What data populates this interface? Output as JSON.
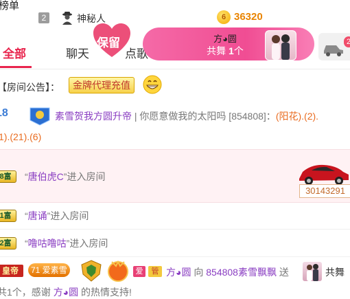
{
  "rank": {
    "label": "榜单",
    "position": "2",
    "user_name": "神秘人",
    "coin_symbol": "6",
    "coin_value": "36320"
  },
  "tabs": {
    "all": "全部",
    "chat": "聊天",
    "song": "点歌",
    "heart_label": "保留",
    "car_count": "2"
  },
  "banner": {
    "title": "方◕圆",
    "sub_prefix": "共舞 ",
    "sub_count": "1",
    "sub_suffix": "个"
  },
  "notice": {
    "label": "【房间公告】：",
    "button": "金牌代理充值"
  },
  "msg1": {
    "level": "18",
    "sender": "素雪贺我方圆升帝",
    "separator": " | ",
    "song": "你愿意做我的太阳吗",
    "id": " [854808]：",
    "content1": "(阳花).(2).",
    "content2": "1).(21).(6)"
  },
  "enter1": {
    "badge": "8富",
    "quote_open": "“",
    "name": "唐伯虎C",
    "quote_close": "”",
    "action": "进入房间",
    "car_price": "30143291"
  },
  "enter2": {
    "badge": "1富",
    "quote_open": "“",
    "name": "唐诵",
    "quote_close": "”",
    "action": "进入房间"
  },
  "enter3": {
    "badge": "2富",
    "quote_open": "“",
    "name": "噜咕噜咕",
    "quote_close": "”",
    "action": "进入房间"
  },
  "gift": {
    "emperor": "皇帝",
    "level": "71 爱素雪",
    "love": "爱",
    "guan": "管",
    "sender": "方◕圆",
    "to": " 向 ",
    "receiver": "854808素雪飘飘",
    "send": " 送 ",
    "dance": "共舞",
    "line2_count": "共1个，感谢 ",
    "line2_name": "方◕圆",
    "line2_end": " 的热情支持!"
  },
  "colors": {
    "accent": "#e8244d",
    "banner": "#f04d93",
    "purple": "#8a3ec2",
    "orange": "#e96b1f"
  }
}
